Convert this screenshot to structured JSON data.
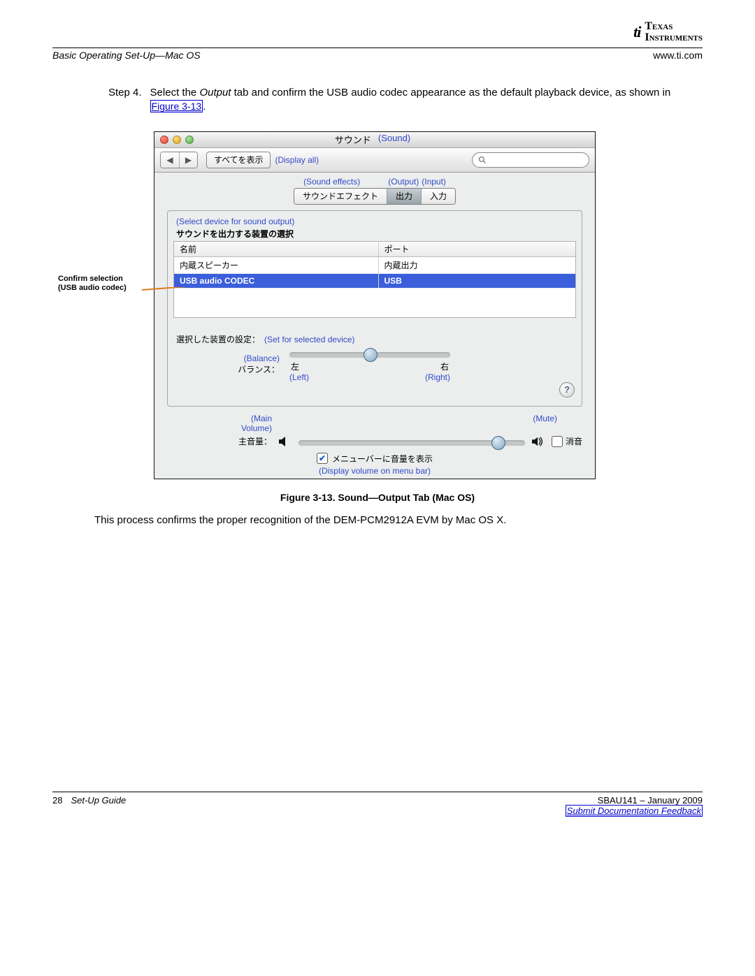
{
  "brand": {
    "mark": "ti",
    "line1": "Texas",
    "line2": "Instruments"
  },
  "header": {
    "section_title": "Basic Operating Set-Up—Mac OS",
    "site": "www.ti.com"
  },
  "step": {
    "label": "Step 4.",
    "body_pre": "Select the ",
    "body_em": "Output",
    "body_mid": " tab and confirm the USB audio codec appearance as the default playback device, as shown in ",
    "fig_link": "Figure 3-13",
    "body_post": "."
  },
  "confirm_note": {
    "line1": "Confirm selection",
    "line2": "(USB audio codec)"
  },
  "mac": {
    "title_jp": "サウンド",
    "title_en": "(Sound)",
    "show_all_jp": "すべてを表示",
    "show_all_en": "(Display all)",
    "tab_annot": {
      "se": "(Sound effects)",
      "out": "(Output)",
      "in": "(Input)"
    },
    "tabs": {
      "se": "サウンドエフェクト",
      "out": "出力",
      "in": "入力"
    },
    "select_device_en": "(Select device for sound output)",
    "select_device_jp": "サウンドを出力する装置の選択",
    "table": {
      "head_name": "名前",
      "head_port": "ポート",
      "rows": [
        {
          "name": "内蔵スピーカー",
          "port": "内蔵出力"
        },
        {
          "name": "USB audio CODEC",
          "port": "USB"
        }
      ],
      "selected_index": 1
    },
    "set_for_jp": "選択した装置の設定：",
    "set_for_en": "(Set for selected device)",
    "balance": {
      "en": "(Balance)",
      "jp": "バランス：",
      "left_jp": "左",
      "right_jp": "右",
      "left_en": "(Left)",
      "right_en": "(Right)"
    },
    "main_vol_annot_line1": "(Main",
    "main_vol_annot_line2": "Volume)",
    "main_vol_jp": "主音量：",
    "mute_en": "(Mute)",
    "mute_jp": "消音",
    "menubar_jp": "メニューバーに音量を表示",
    "menubar_en": "(Display volume on menu bar)"
  },
  "figure_caption": "Figure 3-13. Sound—Output Tab (Mac OS)",
  "conclusion": "This process confirms the proper recognition of the DEM-PCM2912A EVM by Mac OS X.",
  "footer": {
    "page_no": "28",
    "guide": "Set-Up Guide",
    "doc_id": "SBAU141 – January 2009",
    "feedback": "Submit Documentation Feedback"
  }
}
